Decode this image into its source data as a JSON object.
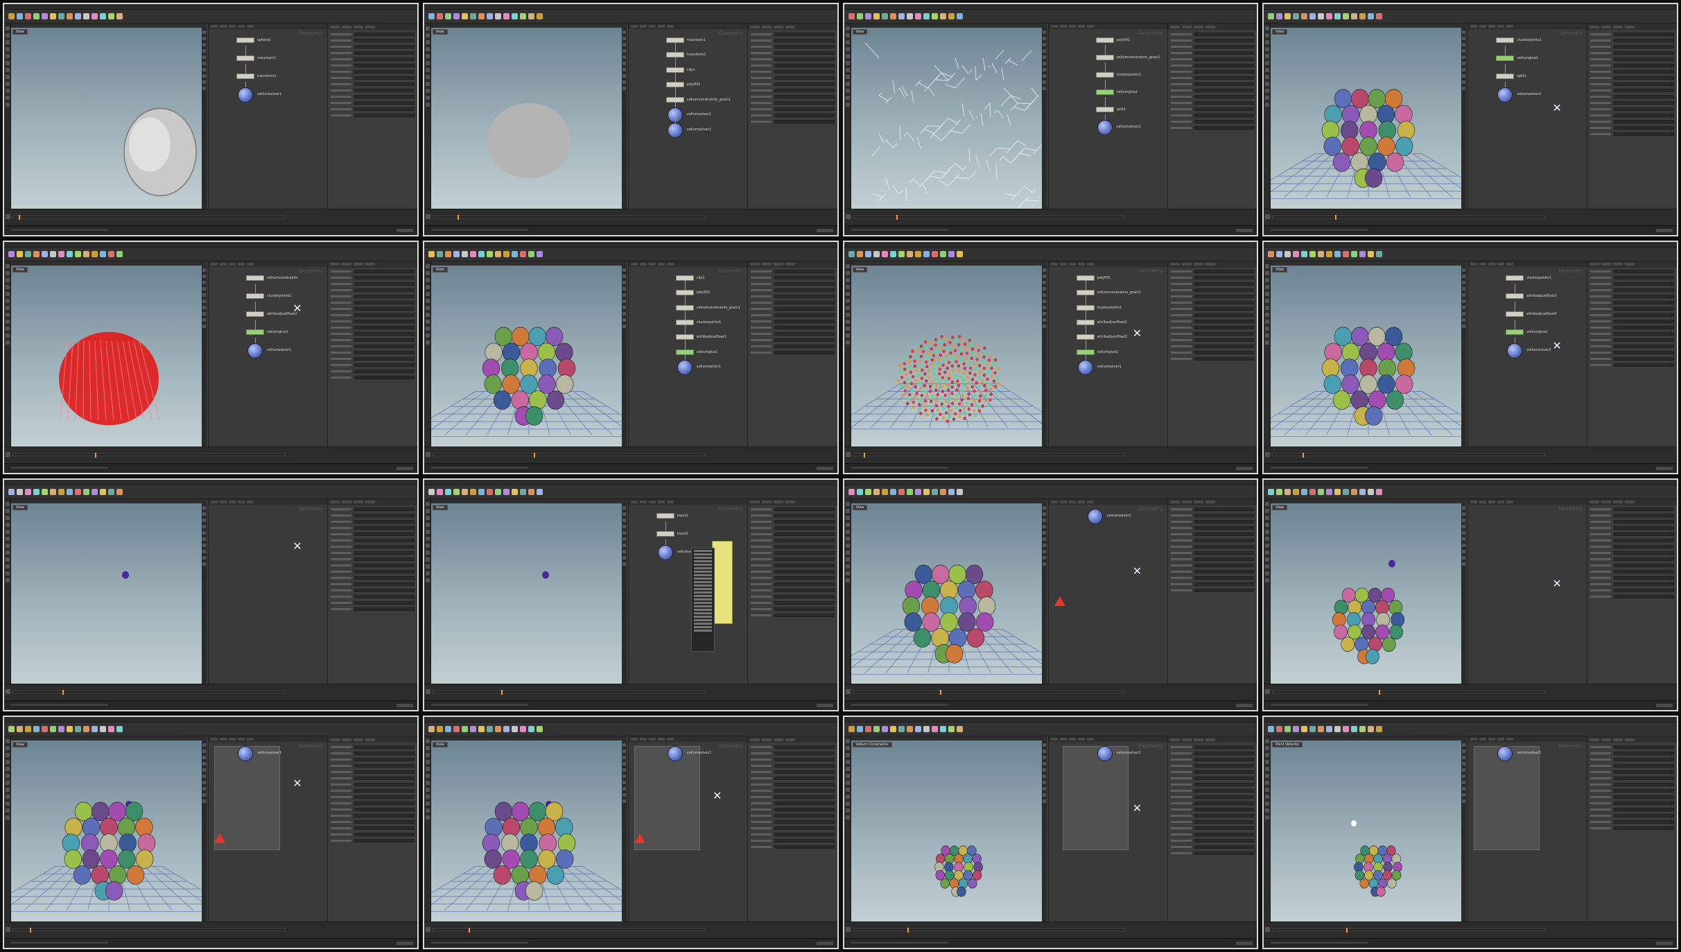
{
  "sheet": {
    "tiles": [
      {
        "viewport_tab": "View",
        "nodes": [
          "sphere1",
          "mountain1",
          "transform1",
          "vellumsolver1"
        ],
        "scene": "rock"
      },
      {
        "viewport_tab": "View",
        "nodes": [
          "mountain1",
          "transform1",
          "clip1",
          "polyfill1",
          "vellumconstraints_grain1",
          "vellumsolver1",
          "vellumsolver1"
        ],
        "scene": "grey"
      },
      {
        "viewport_tab": "View",
        "nodes": [
          "polyfill1",
          "vellumconstraints_grain1",
          "clusterpoints1",
          "vellumglue1",
          "split1",
          "vellumsolver1"
        ],
        "scene": "wire"
      },
      {
        "viewport_tab": "View",
        "nodes": [
          "clusterpoints1",
          "vellumglue1",
          "split1",
          "vellumsolver1"
        ],
        "scene": "cluster-grid"
      },
      {
        "viewport_tab": "View",
        "nodes": [
          "vellumconstraints",
          "clusterpoints1",
          "attribadjustfloat2",
          "vellumglue1",
          "vellumsolver1"
        ],
        "scene": "red"
      },
      {
        "viewport_tab": "View",
        "nodes": [
          "clip1",
          "polyfill1",
          "vellumconstraints_grain1",
          "clusterpoints1",
          "attribadjustfloat1",
          "vellumglue1",
          "vellumsolver1"
        ],
        "scene": "cluster-grid"
      },
      {
        "viewport_tab": "View",
        "nodes": [
          "polyfill1",
          "vellumconstraints_grain1",
          "clusterpoints1",
          "attribadjustfloat1",
          "attribadjustfloat2",
          "vellumglue1",
          "vellumsolver1"
        ],
        "scene": "noise"
      },
      {
        "viewport_tab": "View",
        "nodes": [
          "clusterpoints1",
          "attribadjustfloat3",
          "attribadjustfloat4",
          "vellumglue1",
          "vellumsolver2"
        ],
        "scene": "cluster-grid"
      },
      {
        "viewport_tab": "View",
        "nodes": [],
        "scene": "dot"
      },
      {
        "viewport_tab": "View",
        "nodes": [
          "input1",
          "input2",
          "vellumsolver1"
        ],
        "scene": "dot"
      },
      {
        "viewport_tab": "View",
        "nodes": [
          "vellumsolver1"
        ],
        "scene": "cluster-grid"
      },
      {
        "viewport_tab": "View",
        "nodes": [],
        "scene": "cluster-dot"
      },
      {
        "viewport_tab": "View",
        "nodes": [
          "vellumsolver1"
        ],
        "scene": "cluster-grid-dot"
      },
      {
        "viewport_tab": "View",
        "nodes": [
          "vellumsolver1"
        ],
        "scene": "cluster-grid-dot"
      },
      {
        "viewport_tab": "Vellum Constraints",
        "nodes": [
          "vellumsolver1"
        ],
        "scene": "cluster-small"
      },
      {
        "viewport_tab": "Point Velocity",
        "nodes": [
          "vellumsolver1"
        ],
        "scene": "cluster-small-white"
      }
    ]
  },
  "network_context": "Geometry",
  "colors": {
    "background": "#0d0d0d",
    "tile_border": "#d9d9d9",
    "viewport_top": "#6d8493",
    "viewport_bottom": "#c2d0d2",
    "solver_blue": "#6177c9",
    "node_green": "#9ad07a",
    "timeline_cursor": "#ff9a2e",
    "warning_red": "#e0392b"
  },
  "icons": [
    "vellum-solver-icon",
    "bypass-x-icon",
    "warning-icon",
    "play-icon",
    "shelf-tool-icon"
  ]
}
